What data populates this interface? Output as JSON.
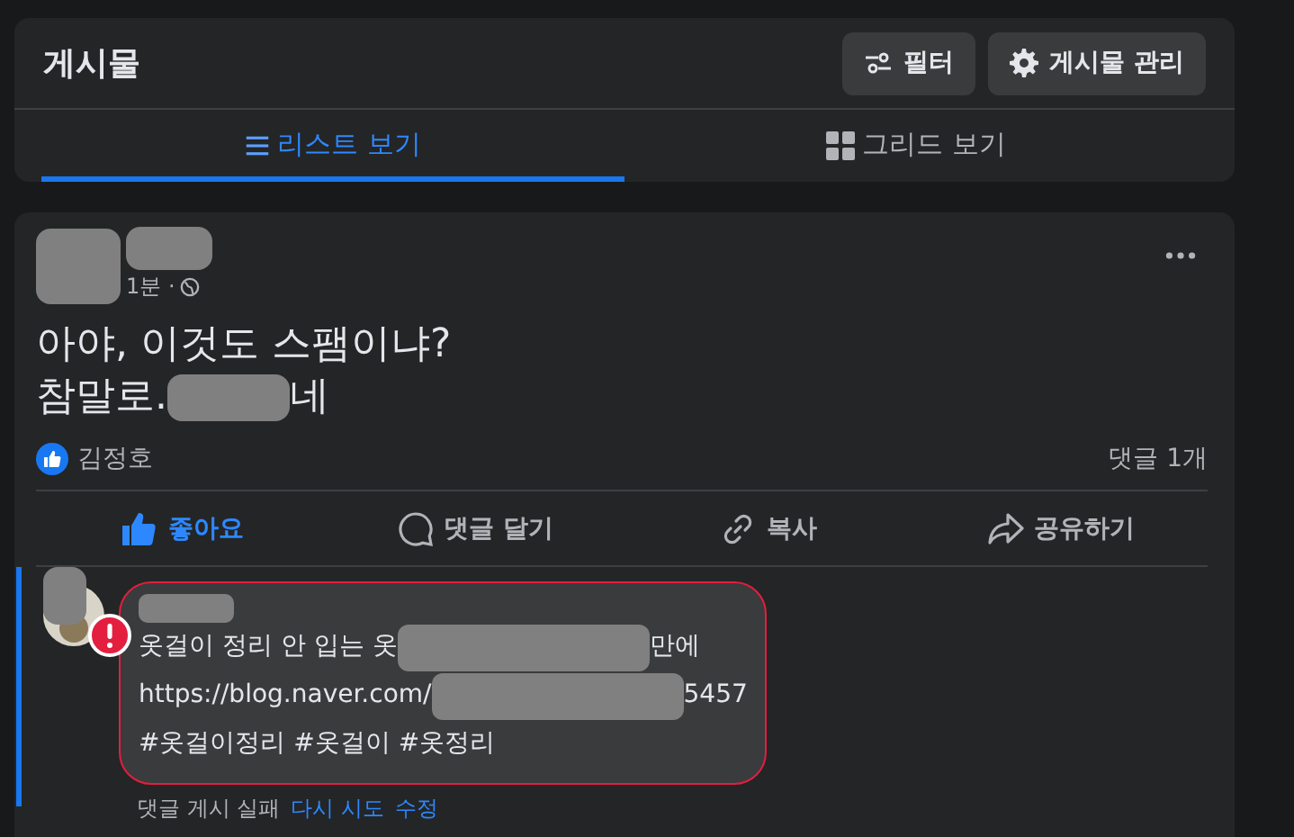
{
  "header": {
    "title": "게시물",
    "buttons": [
      {
        "label": "필터"
      },
      {
        "label": "게시물 관리"
      }
    ]
  },
  "tabs": [
    {
      "label": "리스트 보기",
      "selected": true
    },
    {
      "label": "그리드 보기",
      "selected": false
    }
  ],
  "post": {
    "time": "1분 ·",
    "lines": [
      [
        {
          "kind": "text",
          "text": "아야, 이것도 스팸이냐?"
        }
      ],
      [
        {
          "kind": "text",
          "text": "참말로."
        },
        {
          "kind": "redacted"
        },
        {
          "kind": "text",
          "text": "네"
        }
      ]
    ],
    "reaction_name": "김정호",
    "comment_count": "댓글 1개",
    "actions": [
      {
        "label": "좋아요",
        "selected": true
      },
      {
        "label": "댓글 달기",
        "selected": false
      },
      {
        "label": "복사",
        "selected": false
      },
      {
        "label": "공유하기",
        "selected": false
      }
    ]
  },
  "comment": {
    "failed": true,
    "lines": [
      [
        {
          "kind": "text",
          "text": "옷걸이 정리 안 입는 옷 "
        },
        {
          "kind": "redacted"
        },
        {
          "kind": "text",
          "text": "만에"
        }
      ],
      [
        {
          "kind": "text",
          "text": "https://blog.naver.com/"
        },
        {
          "kind": "redacted"
        },
        {
          "kind": "text",
          "text": "5457"
        }
      ],
      [
        {
          "kind": "text",
          "text": "#옷걸이정리 #옷걸이 #옷정리"
        }
      ]
    ],
    "status": "댓글 게시 실패",
    "links": [
      "다시 시도",
      "수정"
    ]
  }
}
